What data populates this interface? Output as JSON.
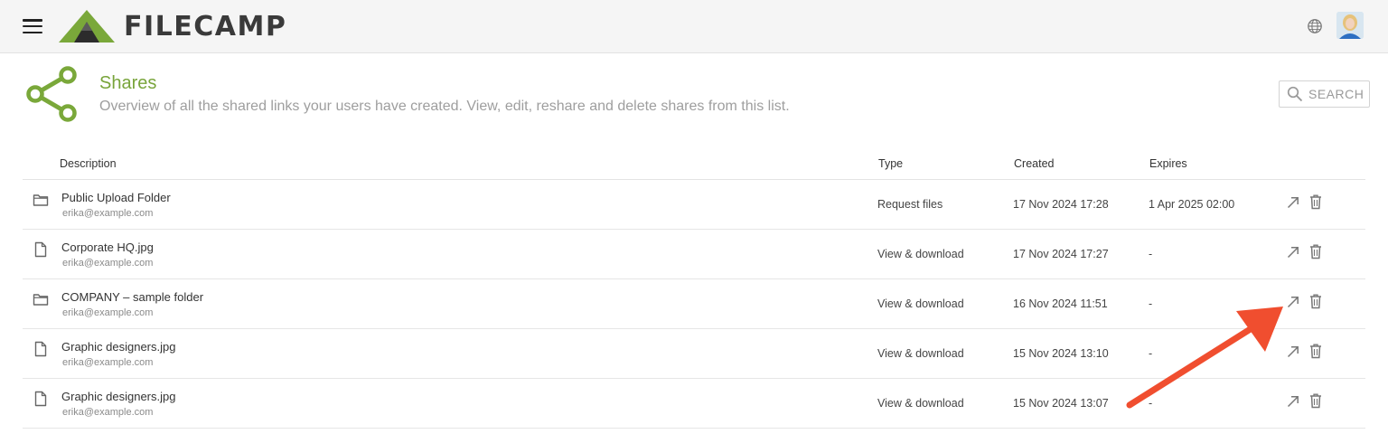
{
  "app": {
    "brand": "FILECAMP",
    "accent_color": "#78a43a",
    "icons": {
      "menu": "hamburger-icon",
      "language": "globe-icon",
      "user": "avatar"
    }
  },
  "header": {
    "title": "Shares",
    "subtitle": "Overview of all the shared links your users have created. View, edit, reshare and delete shares from this list.",
    "search_label": "SEARCH"
  },
  "table": {
    "columns": {
      "description": "Description",
      "type": "Type",
      "created": "Created",
      "expires": "Expires"
    },
    "rows": [
      {
        "icon": "folder-icon",
        "name": "Public Upload Folder",
        "owner": "erika@example.com",
        "type": "Request files",
        "created": "17 Nov 2024 17:28",
        "expires": "1 Apr 2025 02:00"
      },
      {
        "icon": "file-icon",
        "name": "Corporate HQ.jpg",
        "owner": "erika@example.com",
        "type": "View & download",
        "created": "17 Nov 2024 17:27",
        "expires": "-"
      },
      {
        "icon": "folder-icon",
        "name": "COMPANY – sample folder",
        "owner": "erika@example.com",
        "type": "View & download",
        "created": "16 Nov 2024 11:51",
        "expires": "-"
      },
      {
        "icon": "file-icon",
        "name": "Graphic designers.jpg",
        "owner": "erika@example.com",
        "type": "View & download",
        "created": "15 Nov 2024 13:10",
        "expires": "-"
      },
      {
        "icon": "file-icon",
        "name": "Graphic designers.jpg",
        "owner": "erika@example.com",
        "type": "View & download",
        "created": "15 Nov 2024 13:07",
        "expires": "-"
      }
    ]
  },
  "annotation": {
    "color": "#f04e2f",
    "points_to": "open-share-button"
  }
}
